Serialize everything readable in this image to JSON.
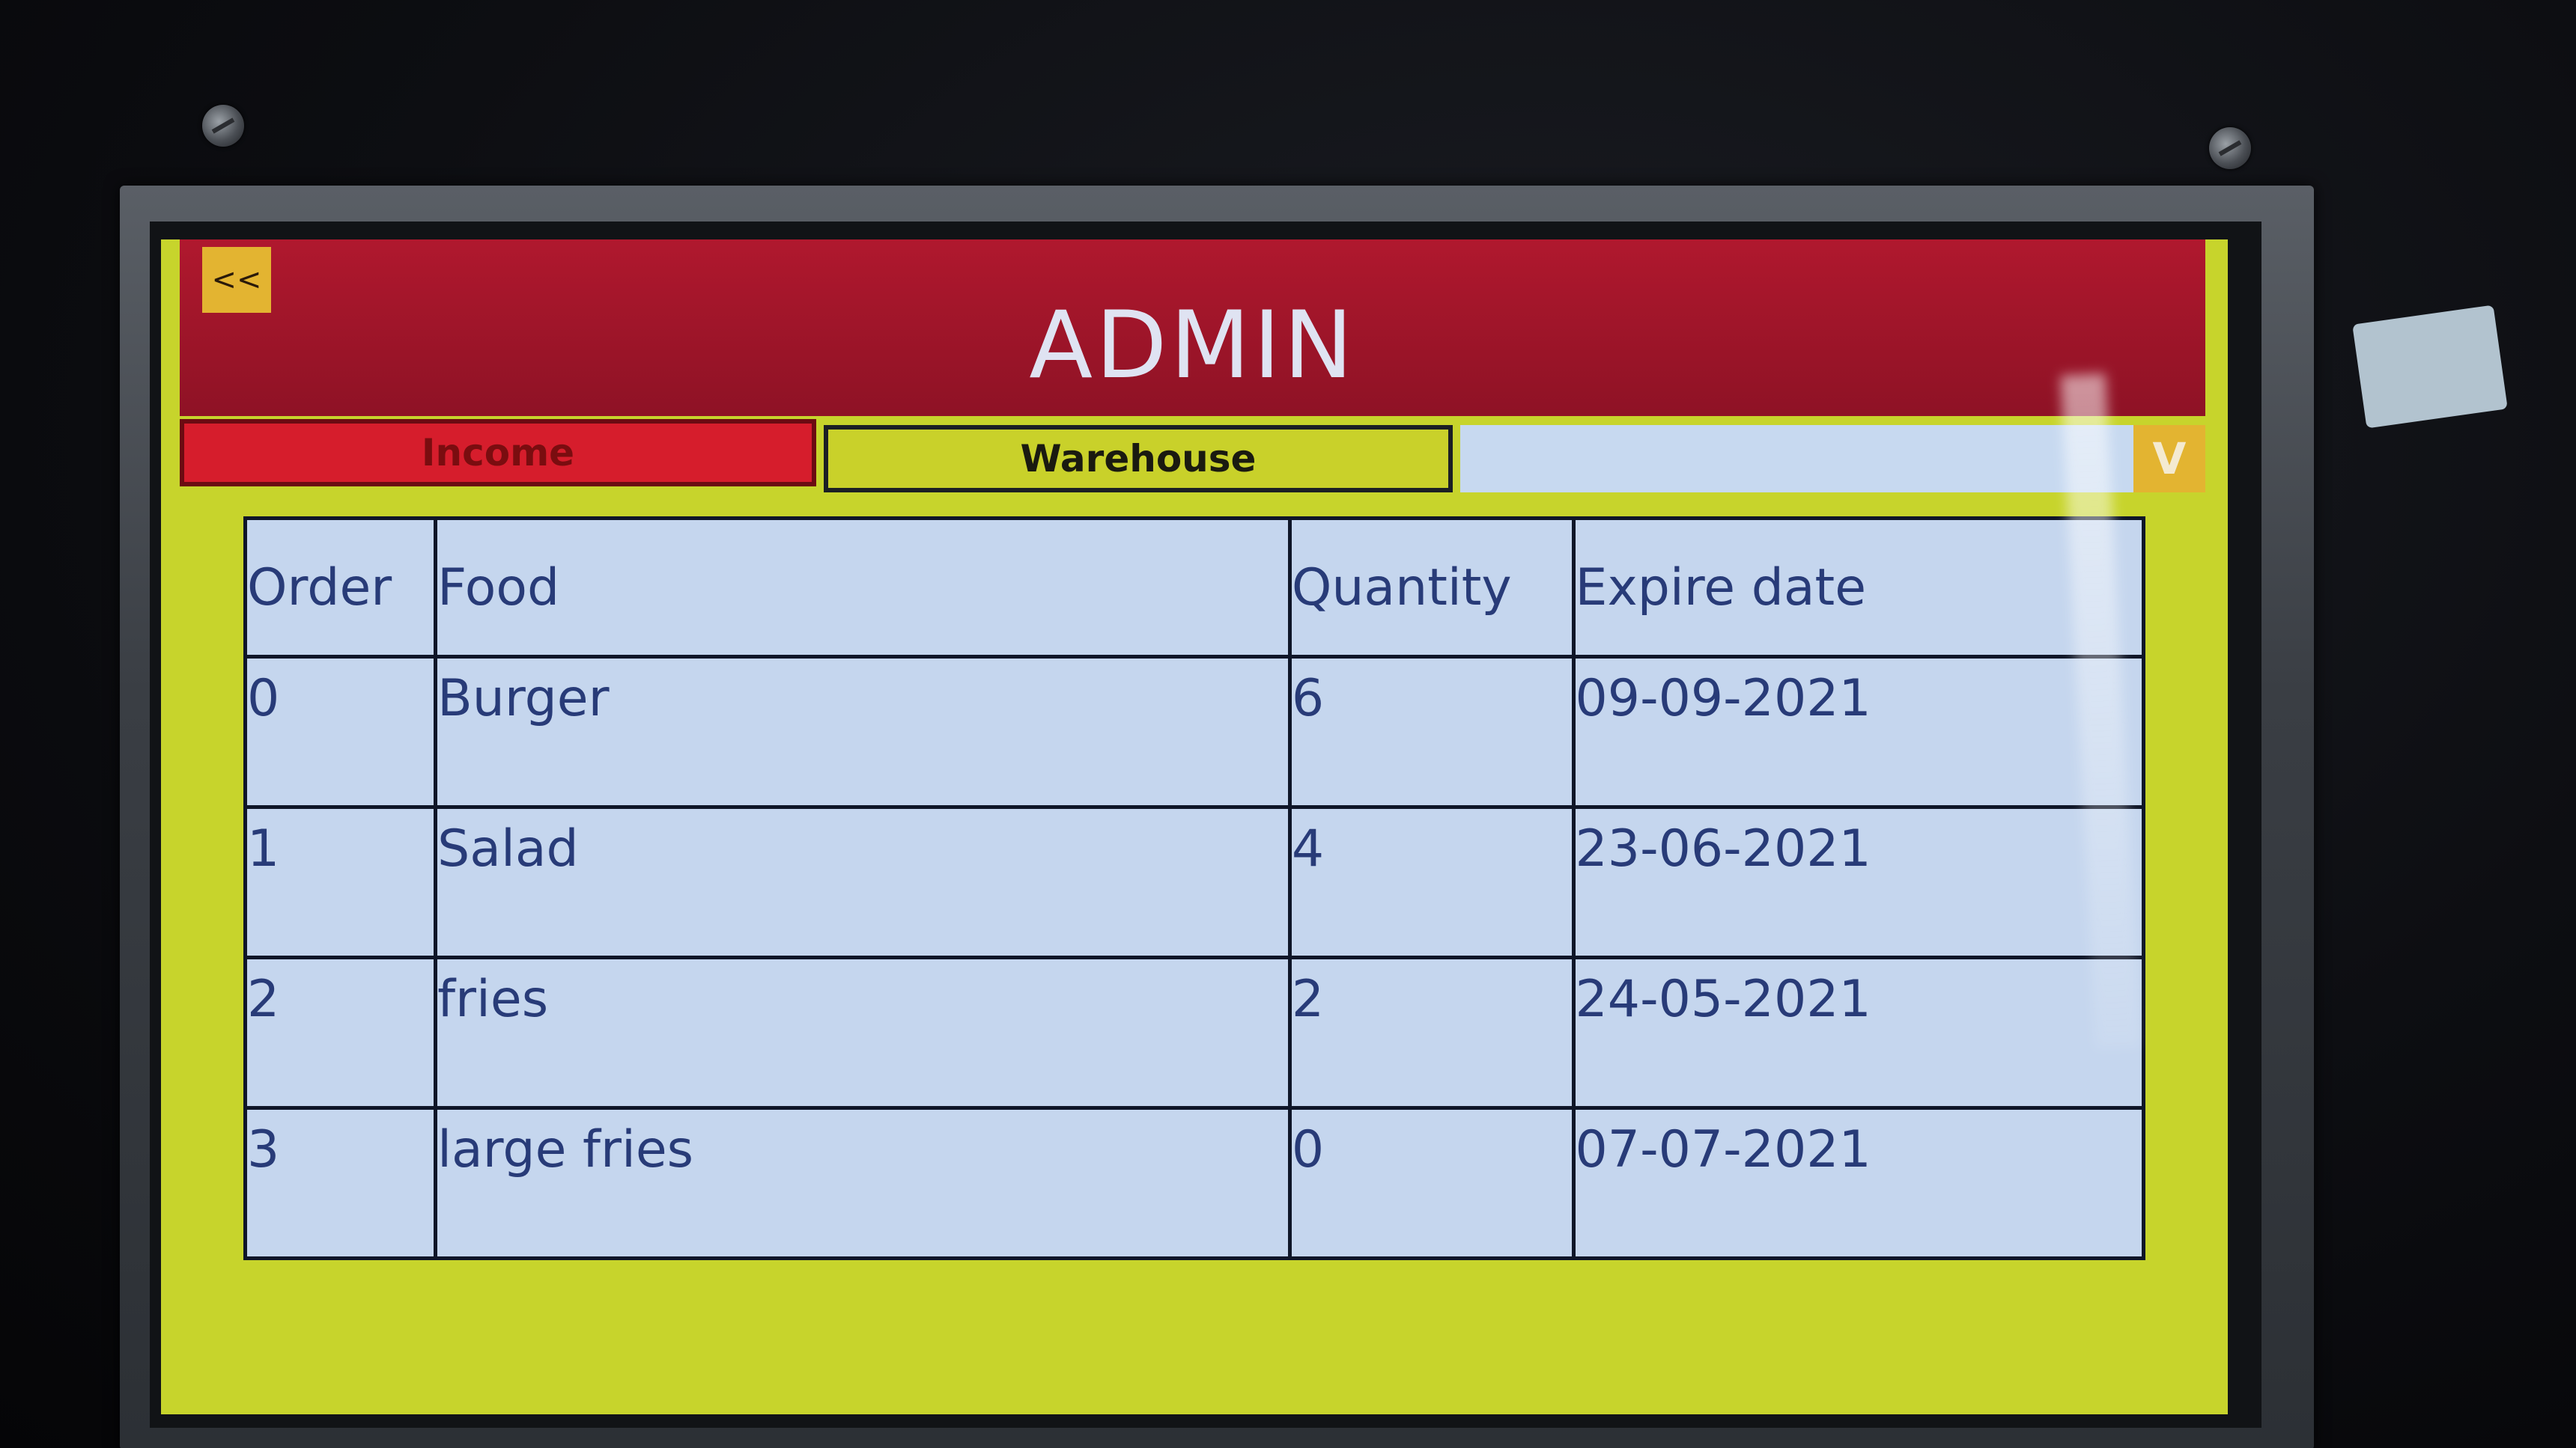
{
  "header": {
    "back_label": "<<",
    "title": "ADMIN"
  },
  "tabs": {
    "income": "Income",
    "warehouse": "Warehouse",
    "dropdown_label": "V"
  },
  "table": {
    "headers": [
      "Order",
      "Food",
      "Quantity",
      "Expire date"
    ],
    "rows": [
      [
        "0",
        "Burger",
        "6",
        "09-09-2021"
      ],
      [
        "1",
        "Salad",
        "4",
        "23-06-2021"
      ],
      [
        "2",
        "fries",
        "2",
        "24-05-2021"
      ],
      [
        "3",
        "large fries",
        "0",
        "07-07-2021"
      ]
    ]
  },
  "colors": {
    "header_bg": "#a0162a",
    "screen_bg": "#c7d42c",
    "table_bg": "#c5d6ee",
    "accent_button": "#e3b431",
    "income_tab": "#d61d2c"
  }
}
